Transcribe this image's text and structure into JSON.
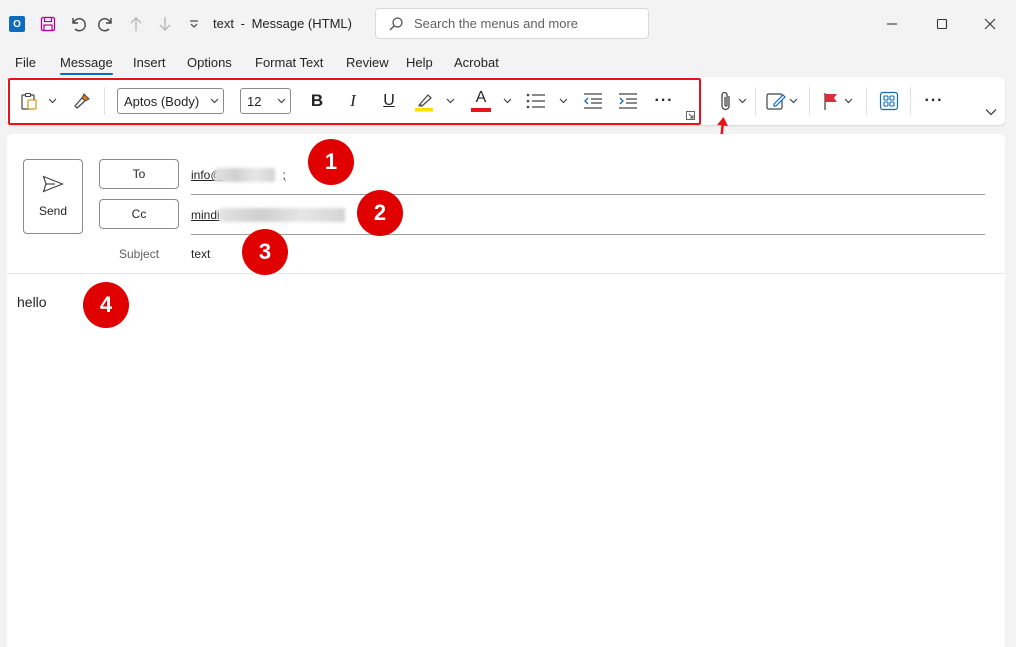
{
  "window": {
    "title": "text",
    "title_separator": "-",
    "title_suffix": "Message (HTML)",
    "search_placeholder": "Search the menus and more"
  },
  "menu": [
    "File",
    "Message",
    "Insert",
    "Options",
    "Format Text",
    "Review",
    "Help",
    "Acrobat"
  ],
  "ribbon": {
    "font_name": "Aptos (Body)",
    "font_size": "12",
    "bold": "B",
    "italic": "I",
    "underline": "U",
    "font_color_letter": "A",
    "highlight_color": "#f5e100",
    "font_color": "#e8141b",
    "more": "···"
  },
  "compose": {
    "send_label": "Send",
    "to_label": "To",
    "cc_label": "Cc",
    "to_value": "info@",
    "to_suffix": ";",
    "cc_value": "mindi",
    "subject_label": "Subject",
    "subject_value": "text",
    "body": "hello"
  },
  "annotations": [
    "1",
    "2",
    "3",
    "4"
  ],
  "colors": {
    "accent": "#0f6cbd",
    "annotation_red": "#e00000"
  }
}
